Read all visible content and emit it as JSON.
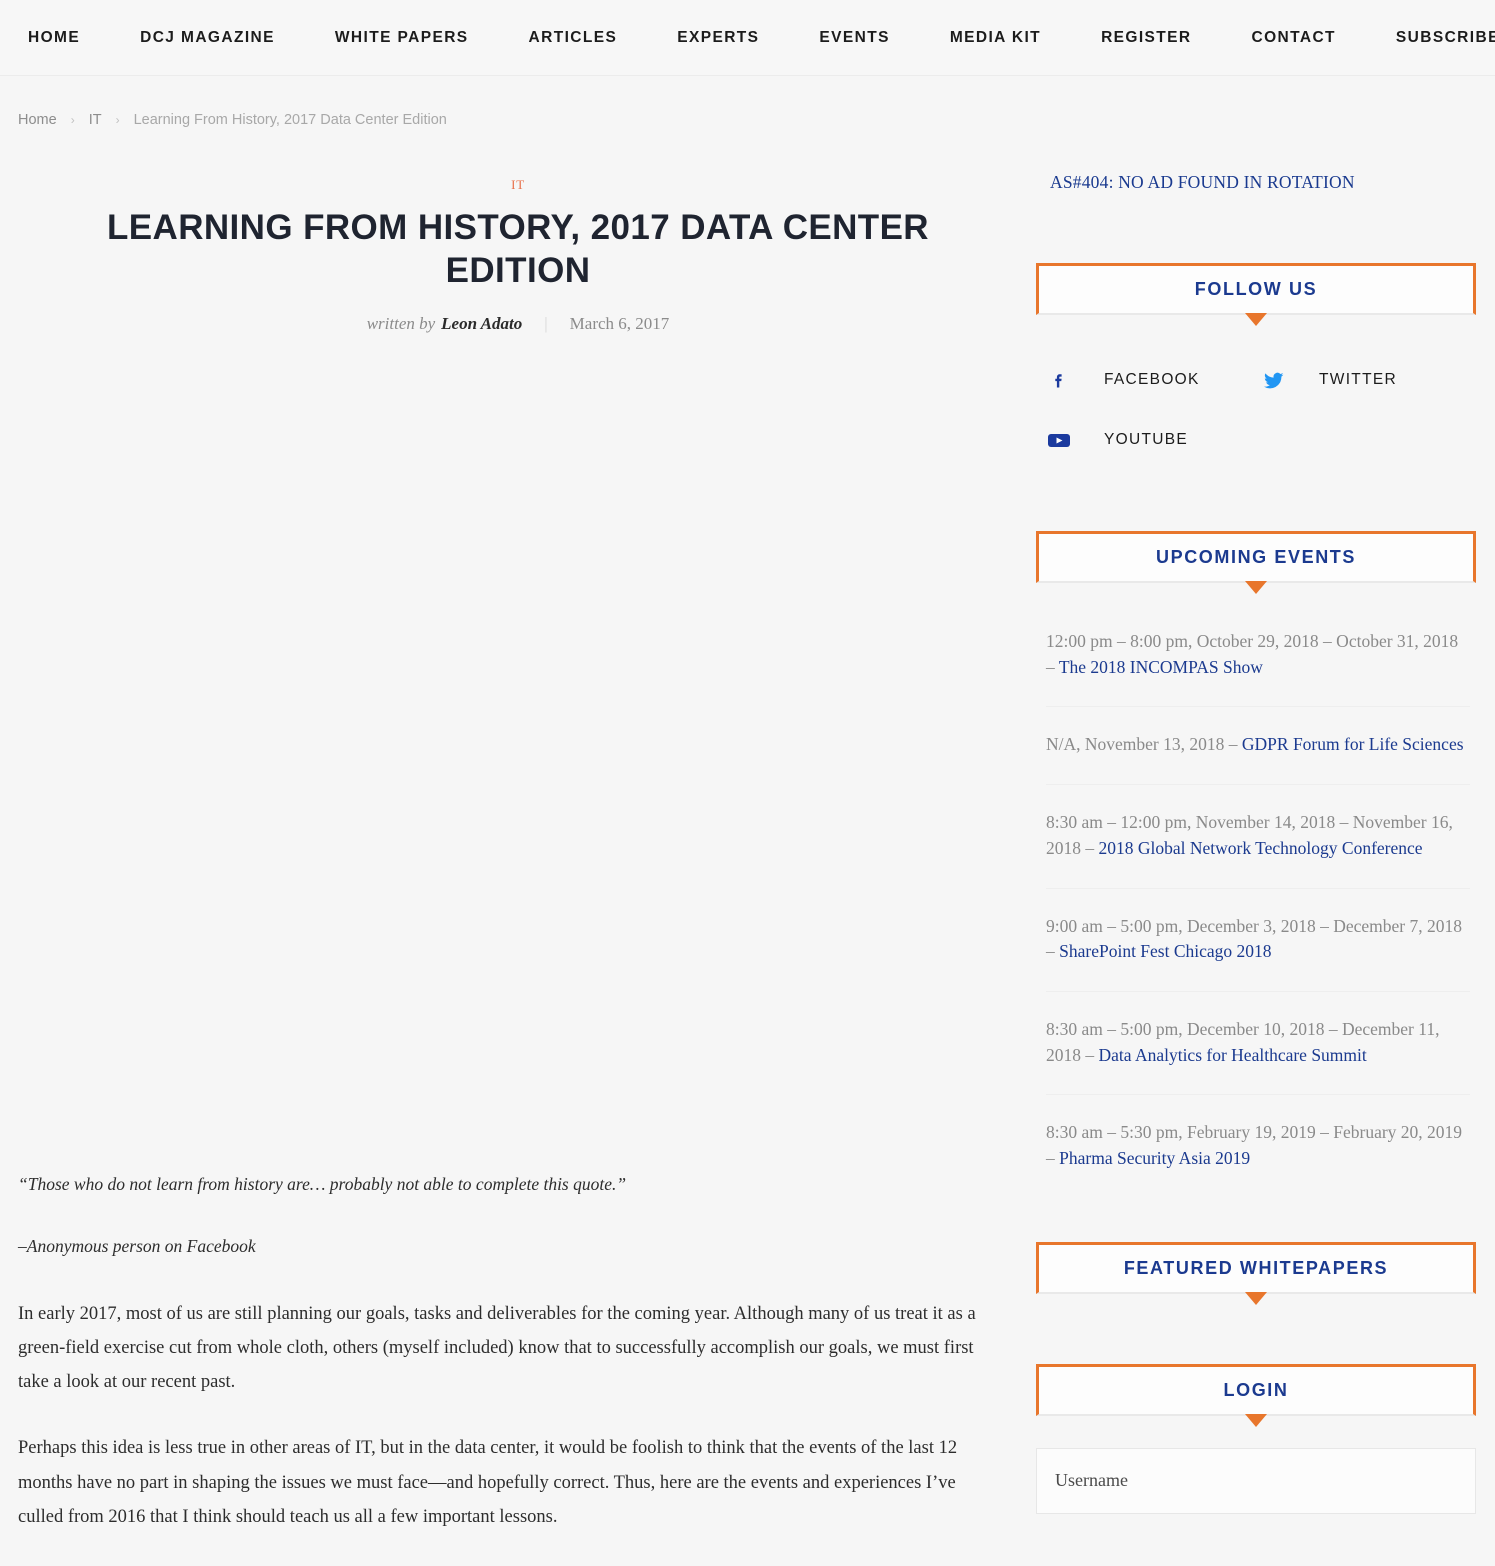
{
  "nav": {
    "items": [
      {
        "label": "HOME"
      },
      {
        "label": "DCJ MAGAZINE"
      },
      {
        "label": "WHITE PAPERS"
      },
      {
        "label": "ARTICLES"
      },
      {
        "label": "EXPERTS"
      },
      {
        "label": "EVENTS"
      },
      {
        "label": "MEDIA KIT"
      },
      {
        "label": "REGISTER"
      },
      {
        "label": "CONTACT"
      },
      {
        "label": "SUBSCRIBE"
      }
    ],
    "search_icon": "search-icon"
  },
  "breadcrumb": {
    "items": [
      "Home",
      "IT",
      "Learning From History, 2017 Data Center Edition"
    ],
    "separator": "›"
  },
  "article": {
    "category": "IT",
    "title": "LEARNING FROM HISTORY, 2017 DATA CENTER EDITION",
    "written_by_label": "written by",
    "author": "Leon Adato",
    "byline_divider": "|",
    "date": "March 6, 2017",
    "quote": "“Those who do not learn from history are… probably not able to complete this quote.”",
    "quote_attribution": "–Anonymous person on Facebook",
    "paragraphs": [
      "In early 2017, most of us are still planning our goals, tasks and deliverables for the coming year. Although many of us treat it as a green-field exercise cut from whole cloth, others (myself included) know that to successfully accomplish our goals, we must first take a look at our recent past.",
      "Perhaps this idea is less true in other areas of IT, but in the data center, it would be foolish to think that the events of the last 12 months have no part in shaping the issues we must face—and hopefully correct. Thus, here are the events and experiences I’ve culled from 2016 that I think should teach us all a few important lessons."
    ]
  },
  "sidebar": {
    "ad_notice": "AS#404: NO AD FOUND IN ROTATION",
    "follow_us": {
      "title": "FOLLOW US",
      "links": [
        {
          "label": "FACEBOOK",
          "icon": "facebook-icon"
        },
        {
          "label": "TWITTER",
          "icon": "twitter-icon"
        },
        {
          "label": "YOUTUBE",
          "icon": "youtube-icon"
        }
      ]
    },
    "upcoming_events": {
      "title": "UPCOMING EVENTS",
      "events": [
        {
          "when": "12:00 pm – 8:00 pm, October 29, 2018 – October 31, 2018 – ",
          "name": "The 2018 INCOMPAS Show"
        },
        {
          "when": "N/A, November 13, 2018 – ",
          "name": "GDPR Forum for Life Sciences"
        },
        {
          "when": "8:30 am – 12:00 pm, November 14, 2018 – November 16, 2018 – ",
          "name": "2018 Global Network Technology Conference"
        },
        {
          "when": "9:00 am – 5:00 pm, December 3, 2018 – December 7, 2018 – ",
          "name": "SharePoint Fest Chicago 2018"
        },
        {
          "when": "8:30 am – 5:00 pm, December 10, 2018 – December 11, 2018 – ",
          "name": "Data Analytics for Healthcare Summit"
        },
        {
          "when": "8:30 am – 5:30 pm, February 19, 2019 – February 20, 2019 – ",
          "name": "Pharma Security Asia 2019"
        }
      ]
    },
    "featured_whitepapers": {
      "title": "FEATURED WHITEPAPERS"
    },
    "login": {
      "title": "LOGIN",
      "username_placeholder": "Username"
    }
  },
  "colors": {
    "accent_orange": "#e8762c",
    "link_blue": "#1b3a8f",
    "category_orange": "#e8704a",
    "page_bg": "#f6f6f6",
    "text_dark": "#1f2430"
  }
}
